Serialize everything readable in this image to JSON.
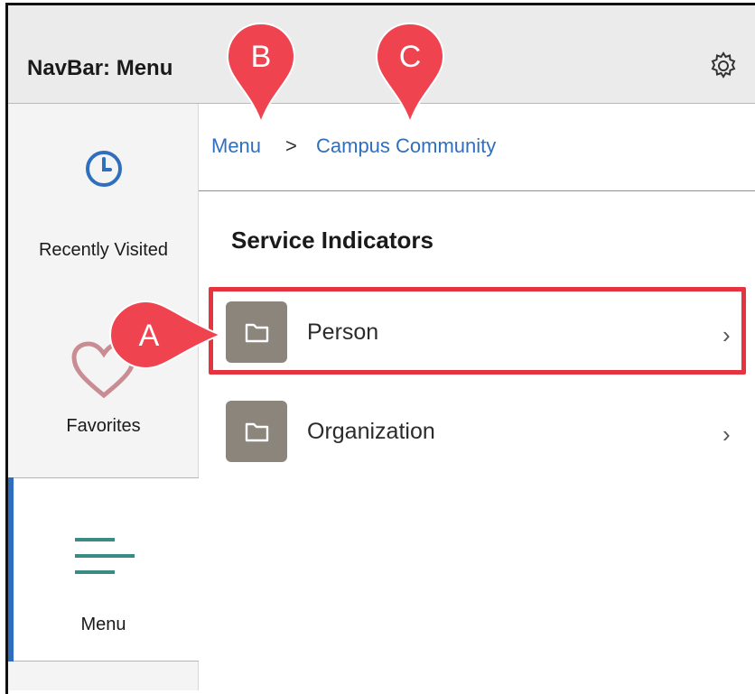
{
  "header": {
    "title": "NavBar: Menu"
  },
  "sidebar": {
    "items": [
      {
        "label": "Recently Visited"
      },
      {
        "label": "Favorites"
      },
      {
        "label": "Menu"
      }
    ]
  },
  "breadcrumb": {
    "items": [
      "Menu",
      "Campus Community"
    ],
    "separator": ">"
  },
  "main": {
    "section_title": "Service Indicators",
    "rows": [
      {
        "label": "Person"
      },
      {
        "label": "Organization"
      }
    ]
  },
  "callouts": {
    "a": "A",
    "b": "B",
    "c": "C"
  },
  "colors": {
    "accent": "#2f6fbe",
    "active_bar": "#2d6ec2",
    "callout": "#ef4450",
    "highlight": "#e63340",
    "folder": "#8b857c"
  }
}
